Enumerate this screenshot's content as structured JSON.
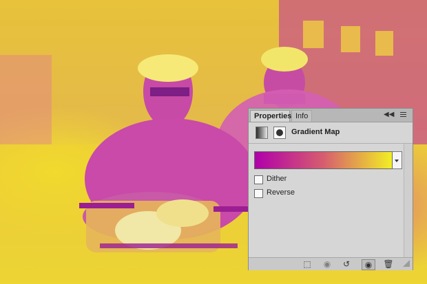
{
  "panel": {
    "tabs": [
      {
        "label": "Properties"
      },
      {
        "label": "Info"
      }
    ],
    "title": "Gradient Map",
    "gradient": {
      "colors": [
        "#b000aa",
        "#f2ef24"
      ]
    },
    "options": {
      "dither_label": "Dither",
      "reverse_label": "Reverse",
      "dither_checked": false,
      "reverse_checked": false
    },
    "footer": {
      "icons": [
        "clip-to-layer-icon",
        "previous-state-icon",
        "reset-icon",
        "visibility-eye-icon",
        "trash-icon"
      ]
    }
  },
  "photo": {
    "palette": [
      "#f3df2d",
      "#d23aa6",
      "#b000aa"
    ]
  }
}
